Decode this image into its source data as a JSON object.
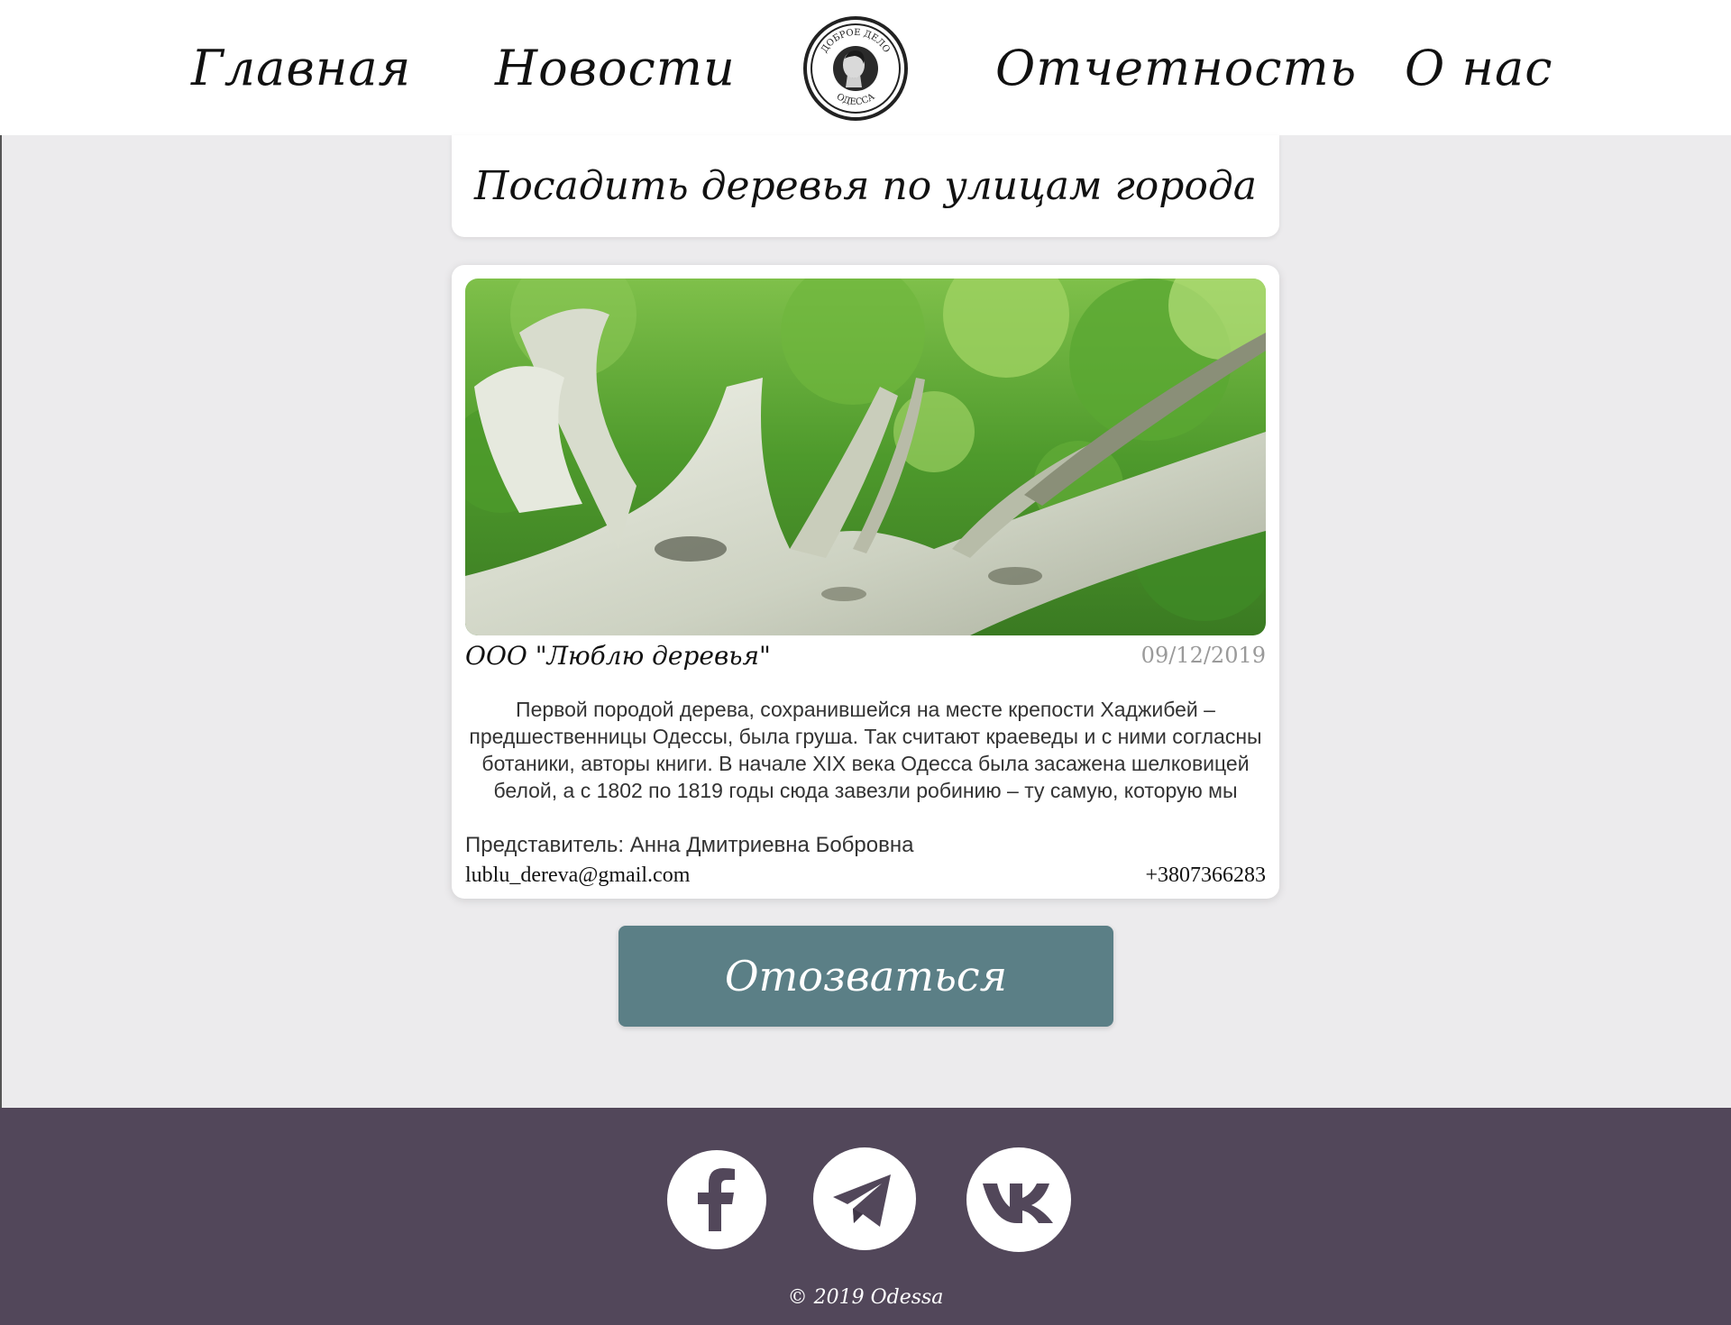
{
  "nav": {
    "home": "Главная",
    "news": "Новости",
    "reports": "Отчетность",
    "about": "О нас"
  },
  "logo": {
    "top_text": "ДОБРОЕ ДЕЛО",
    "bottom_text": "ОДЕССА"
  },
  "post": {
    "title": "Посадить деревья по улицам города",
    "image_icon": "tree-photo",
    "organization": "ООО \"Люблю деревья\"",
    "date": "09/12/2019",
    "description": "Первой породой дерева, сохранившейся на месте крепости Хаджибей – предшественницы Одессы, была груша. Так считают краеведы и с ними согласны ботаники, авторы книги. В начале XIX века Одесса была засажена шелковицей белой, а с 1802 по 1819 годы сюда завезли робинию – ту самую, которую мы",
    "representative": "Представитель: Анна Дмитриевна Бобровна",
    "email": "lublu_dereva@gmail.com",
    "phone": "+3807366283"
  },
  "actions": {
    "respond": "Отозваться"
  },
  "footer": {
    "social": [
      "facebook-icon",
      "telegram-icon",
      "vk-icon"
    ],
    "copyright": "© 2019 Odessa"
  },
  "colors": {
    "page_bg": "#ecebed",
    "button_bg": "#5b7f86",
    "footer_bg": "#52475a",
    "date_text": "#9a9a9a"
  }
}
